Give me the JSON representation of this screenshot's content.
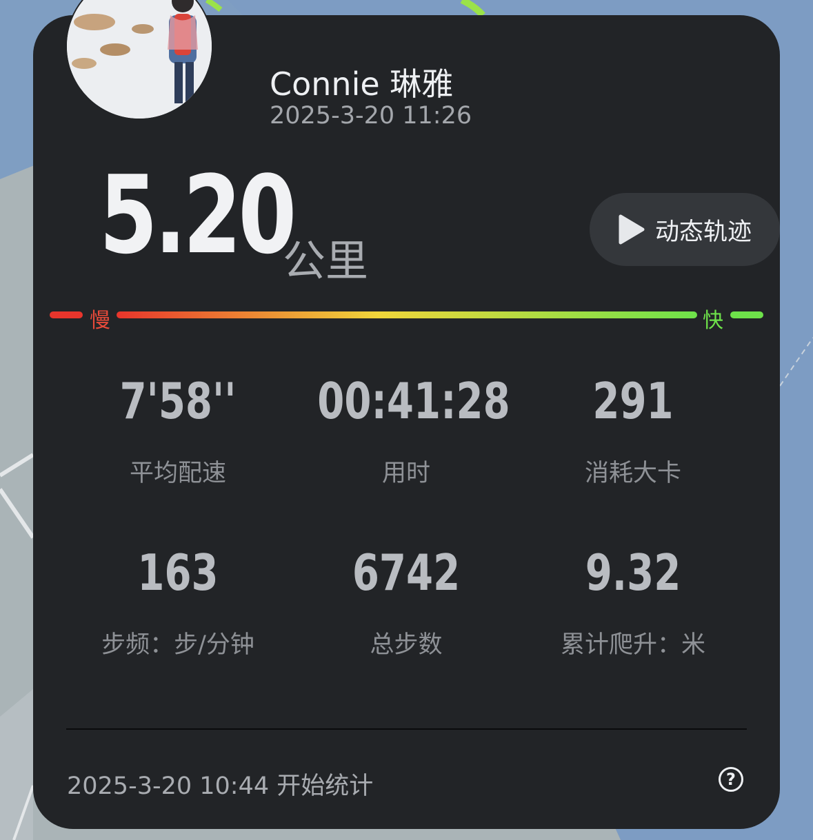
{
  "user": {
    "name": "Connie 琳雅",
    "datetime": "2025-3-20 11:26"
  },
  "distance": {
    "value": "5.20",
    "unit": "公里"
  },
  "track_button": {
    "label": "动态轨迹",
    "icon": "play-icon"
  },
  "pace_legend": {
    "slow": "慢",
    "fast": "快",
    "colors": [
      "#e8352c",
      "#f0d53a",
      "#6ee24a"
    ]
  },
  "stats": [
    {
      "value": "7'58''",
      "label": "平均配速"
    },
    {
      "value": "00:41:28",
      "label": "用时"
    },
    {
      "value": "291",
      "label": "消耗大卡"
    },
    {
      "value": "163",
      "label": "步频：步/分钟"
    },
    {
      "value": "6742",
      "label": "总步数"
    },
    {
      "value": "9.32",
      "label": "累计爬升：米"
    }
  ],
  "footer": {
    "start_text": "2025-3-20 10:44 开始统计",
    "help_icon": "question-circle-icon"
  }
}
